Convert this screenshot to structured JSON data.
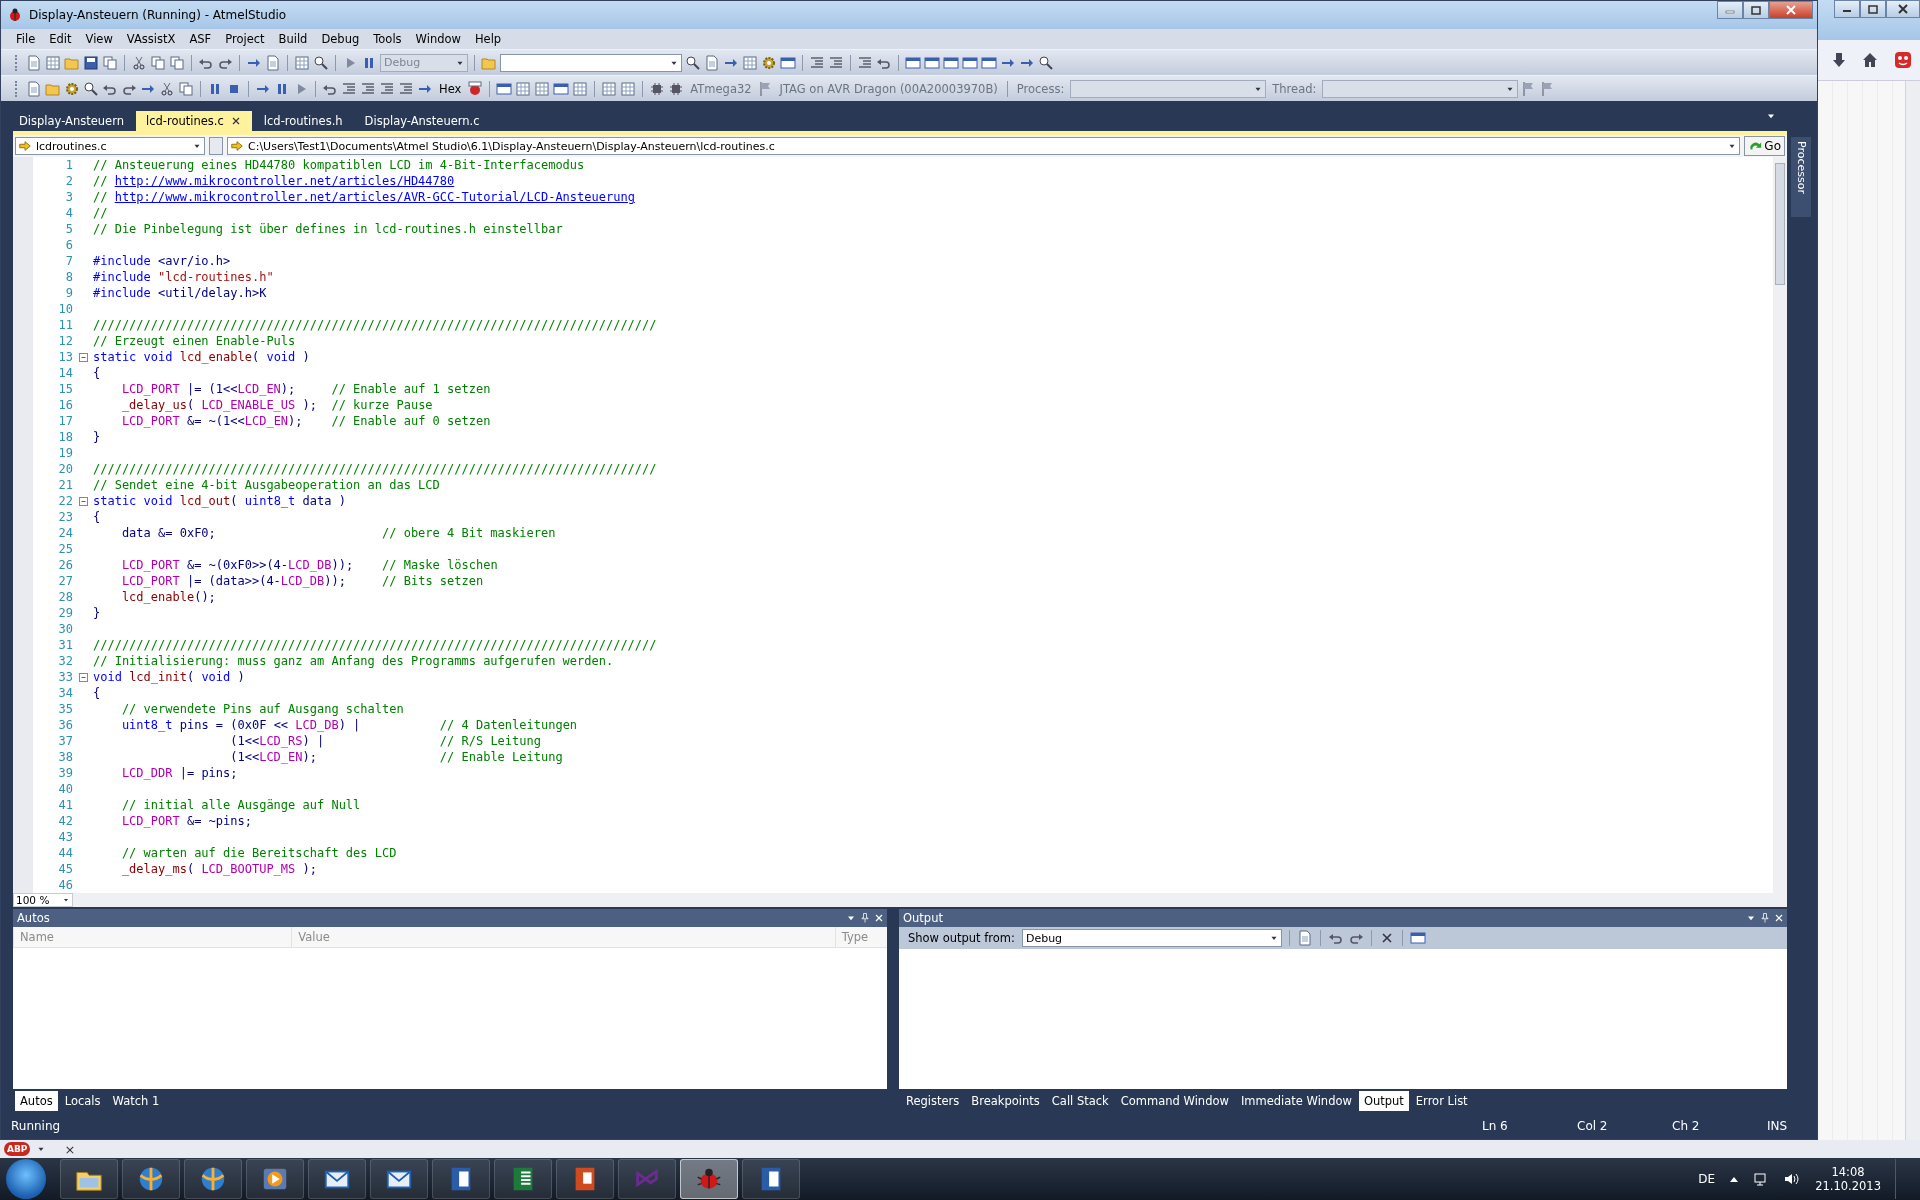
{
  "window": {
    "title": "Display-Ansteuern (Running) - AtmelStudio"
  },
  "menu": [
    "File",
    "Edit",
    "View",
    "VAssistX",
    "ASF",
    "Project",
    "Build",
    "Debug",
    "Tools",
    "Window",
    "Help"
  ],
  "toolbar_1": {
    "configuration": {
      "value": "Debug",
      "disabled": true
    }
  },
  "toolbar_2": {
    "hex": "Hex",
    "device": "ATmega32",
    "tool": "JTAG on AVR Dragon (00A20003970B)",
    "process_label": "Process:",
    "thread_label": "Thread:"
  },
  "doc_tabs": [
    {
      "label": "Display-Ansteuern",
      "selected": false
    },
    {
      "label": "lcd-routines.c",
      "selected": true
    },
    {
      "label": "lcd-routines.h",
      "selected": false
    },
    {
      "label": "Display-Ansteuern.c",
      "selected": false
    }
  ],
  "nav": {
    "file": "lcdroutines.c",
    "path": "C:\\Users\\Test1\\Documents\\Atmel Studio\\6.1\\Display-Ansteuern\\Display-Ansteuern\\lcd-routines.c",
    "go": "Go"
  },
  "side_tab": "Processor",
  "editor": {
    "zoom": "100 %",
    "lines": [
      {
        "n": "1",
        "tokens": [
          {
            "kind": "comment",
            "text": "// Ansteuerung eines HD44780 kompatiblen LCD im 4-Bit-Interfacemodus"
          }
        ]
      },
      {
        "n": "2",
        "tokens": [
          {
            "kind": "comment",
            "text": "// "
          },
          {
            "kind": "link",
            "text": "http://www.mikrocontroller.net/articles/HD44780"
          }
        ]
      },
      {
        "n": "3",
        "tokens": [
          {
            "kind": "comment",
            "text": "// "
          },
          {
            "kind": "link",
            "text": "http://www.mikrocontroller.net/articles/AVR-GCC-Tutorial/LCD-Ansteuerung"
          }
        ]
      },
      {
        "n": "4",
        "tokens": [
          {
            "kind": "comment",
            "text": "//"
          }
        ]
      },
      {
        "n": "5",
        "tokens": [
          {
            "kind": "comment",
            "text": "// Die Pinbelegung ist über defines in lcd-routines.h einstellbar"
          }
        ]
      },
      {
        "n": "6"
      },
      {
        "n": "7",
        "tokens": [
          {
            "kind": "directive",
            "text": "#include"
          },
          {
            "kind": "plain",
            "text": " <avr/io.h>"
          }
        ]
      },
      {
        "n": "8",
        "tokens": [
          {
            "kind": "directive",
            "text": "#include"
          },
          {
            "kind": "string",
            "text": " \"lcd-routines.h\""
          }
        ]
      },
      {
        "n": "9",
        "tokens": [
          {
            "kind": "directive",
            "text": "#include"
          },
          {
            "kind": "plain",
            "text": " <util/delay.h>K"
          }
        ]
      },
      {
        "n": "10"
      },
      {
        "n": "11",
        "tokens": [
          {
            "kind": "comment",
            "text": "//////////////////////////////////////////////////////////////////////////////"
          }
        ]
      },
      {
        "n": "12",
        "tokens": [
          {
            "kind": "comment",
            "text": "// Erzeugt einen Enable-Puls"
          }
        ]
      },
      {
        "n": "13",
        "fold": true,
        "tokens": [
          {
            "kind": "keyword",
            "text": "static void"
          },
          {
            "kind": "func",
            "text": " lcd_enable"
          },
          {
            "kind": "plain",
            "text": "( "
          },
          {
            "kind": "keyword",
            "text": "void"
          },
          {
            "kind": "plain",
            "text": " )"
          }
        ]
      },
      {
        "n": "14",
        "tokens": [
          {
            "kind": "plain",
            "text": "{"
          }
        ]
      },
      {
        "n": "15",
        "tokens": [
          {
            "kind": "macro",
            "text": "    LCD_PORT"
          },
          {
            "kind": "plain",
            "text": " |= (1<<"
          },
          {
            "kind": "macro",
            "text": "LCD_EN"
          },
          {
            "kind": "plain",
            "text": ");"
          },
          {
            "kind": "comment",
            "text": "     // Enable auf 1 setzen"
          }
        ]
      },
      {
        "n": "16",
        "tokens": [
          {
            "kind": "func",
            "text": "    _delay_us"
          },
          {
            "kind": "plain",
            "text": "( "
          },
          {
            "kind": "macro",
            "text": "LCD_ENABLE_US"
          },
          {
            "kind": "plain",
            "text": " );"
          },
          {
            "kind": "comment",
            "text": "  // kurze Pause"
          }
        ]
      },
      {
        "n": "17",
        "tokens": [
          {
            "kind": "macro",
            "text": "    LCD_PORT"
          },
          {
            "kind": "plain",
            "text": " &= ~(1<<"
          },
          {
            "kind": "macro",
            "text": "LCD_EN"
          },
          {
            "kind": "plain",
            "text": ");"
          },
          {
            "kind": "comment",
            "text": "    // Enable auf 0 setzen"
          }
        ]
      },
      {
        "n": "18",
        "tokens": [
          {
            "kind": "plain",
            "text": "}"
          }
        ]
      },
      {
        "n": "19"
      },
      {
        "n": "20",
        "tokens": [
          {
            "kind": "comment",
            "text": "//////////////////////////////////////////////////////////////////////////////"
          }
        ]
      },
      {
        "n": "21",
        "tokens": [
          {
            "kind": "comment",
            "text": "// Sendet eine 4-bit Ausgabeoperation an das LCD"
          }
        ]
      },
      {
        "n": "22",
        "fold": true,
        "tokens": [
          {
            "kind": "keyword",
            "text": "static void"
          },
          {
            "kind": "func",
            "text": " lcd_out"
          },
          {
            "kind": "plain",
            "text": "( "
          },
          {
            "kind": "keyword",
            "text": "uint8_t"
          },
          {
            "kind": "plain",
            "text": " data )"
          }
        ]
      },
      {
        "n": "23",
        "tokens": [
          {
            "kind": "plain",
            "text": "{"
          }
        ]
      },
      {
        "n": "24",
        "tokens": [
          {
            "kind": "plain",
            "text": "    data &= 0xF0;"
          },
          {
            "kind": "comment",
            "text": "                       // obere 4 Bit maskieren"
          }
        ]
      },
      {
        "n": "25"
      },
      {
        "n": "26",
        "tokens": [
          {
            "kind": "macro",
            "text": "    LCD_PORT"
          },
          {
            "kind": "plain",
            "text": " &= ~(0xF0>>(4-"
          },
          {
            "kind": "macro",
            "text": "LCD_DB"
          },
          {
            "kind": "plain",
            "text": "));"
          },
          {
            "kind": "comment",
            "text": "    // Maske löschen"
          }
        ]
      },
      {
        "n": "27",
        "tokens": [
          {
            "kind": "macro",
            "text": "    LCD_PORT"
          },
          {
            "kind": "plain",
            "text": " |= (data>>(4-"
          },
          {
            "kind": "macro",
            "text": "LCD_DB"
          },
          {
            "kind": "plain",
            "text": "));"
          },
          {
            "kind": "comment",
            "text": "     // Bits setzen"
          }
        ]
      },
      {
        "n": "28",
        "tokens": [
          {
            "kind": "func",
            "text": "    lcd_enable"
          },
          {
            "kind": "plain",
            "text": "();"
          }
        ]
      },
      {
        "n": "29",
        "tokens": [
          {
            "kind": "plain",
            "text": "}"
          }
        ]
      },
      {
        "n": "30"
      },
      {
        "n": "31",
        "tokens": [
          {
            "kind": "comment",
            "text": "//////////////////////////////////////////////////////////////////////////////"
          }
        ]
      },
      {
        "n": "32",
        "tokens": [
          {
            "kind": "comment",
            "text": "// Initialisierung: muss ganz am Anfang des Programms aufgerufen werden."
          }
        ]
      },
      {
        "n": "33",
        "fold": true,
        "tokens": [
          {
            "kind": "keyword",
            "text": "void"
          },
          {
            "kind": "func",
            "text": " lcd_init"
          },
          {
            "kind": "plain",
            "text": "( "
          },
          {
            "kind": "keyword",
            "text": "void"
          },
          {
            "kind": "plain",
            "text": " )"
          }
        ]
      },
      {
        "n": "34",
        "tokens": [
          {
            "kind": "plain",
            "text": "{"
          }
        ]
      },
      {
        "n": "35",
        "tokens": [
          {
            "kind": "comment",
            "text": "    // verwendete Pins auf Ausgang schalten"
          }
        ]
      },
      {
        "n": "36",
        "tokens": [
          {
            "kind": "keyword",
            "text": "    uint8_t"
          },
          {
            "kind": "plain",
            "text": " pins = (0x0F << "
          },
          {
            "kind": "macro",
            "text": "LCD_DB"
          },
          {
            "kind": "plain",
            "text": ") |"
          },
          {
            "kind": "comment",
            "text": "           // 4 Datenleitungen"
          }
        ]
      },
      {
        "n": "37",
        "tokens": [
          {
            "kind": "plain",
            "text": "                   (1<<"
          },
          {
            "kind": "macro",
            "text": "LCD_RS"
          },
          {
            "kind": "plain",
            "text": ") |"
          },
          {
            "kind": "comment",
            "text": "                // R/S Leitung"
          }
        ]
      },
      {
        "n": "38",
        "tokens": [
          {
            "kind": "plain",
            "text": "                   (1<<"
          },
          {
            "kind": "macro",
            "text": "LCD_EN"
          },
          {
            "kind": "plain",
            "text": ");"
          },
          {
            "kind": "comment",
            "text": "                 // Enable Leitung"
          }
        ]
      },
      {
        "n": "39",
        "tokens": [
          {
            "kind": "macro",
            "text": "    LCD_DDR"
          },
          {
            "kind": "plain",
            "text": " |= pins;"
          }
        ]
      },
      {
        "n": "40"
      },
      {
        "n": "41",
        "tokens": [
          {
            "kind": "comment",
            "text": "    // initial alle Ausgänge auf Null"
          }
        ]
      },
      {
        "n": "42",
        "tokens": [
          {
            "kind": "macro",
            "text": "    LCD_PORT"
          },
          {
            "kind": "plain",
            "text": " &= ~pins;"
          }
        ]
      },
      {
        "n": "43"
      },
      {
        "n": "44",
        "tokens": [
          {
            "kind": "comment",
            "text": "    // warten auf die Bereitschaft des LCD"
          }
        ]
      },
      {
        "n": "45",
        "tokens": [
          {
            "kind": "func",
            "text": "    _delay_ms"
          },
          {
            "kind": "plain",
            "text": "( "
          },
          {
            "kind": "macro",
            "text": "LCD_BOOTUP_MS"
          },
          {
            "kind": "plain",
            "text": " );"
          }
        ]
      },
      {
        "n": "46"
      }
    ]
  },
  "autos": {
    "title": "Autos",
    "columns": [
      "Name",
      "Value",
      "Type"
    ],
    "tabs": [
      {
        "label": "Autos",
        "selected": true
      },
      {
        "label": "Locals",
        "selected": false
      },
      {
        "label": "Watch 1",
        "selected": false
      }
    ]
  },
  "output": {
    "title": "Output",
    "show_label": "Show output from:",
    "source": "Debug",
    "tabs": [
      {
        "label": "Registers",
        "selected": false
      },
      {
        "label": "Breakpoints",
        "selected": false
      },
      {
        "label": "Call Stack",
        "selected": false
      },
      {
        "label": "Command Window",
        "selected": false
      },
      {
        "label": "Immediate Window",
        "selected": false
      },
      {
        "label": "Output",
        "selected": true
      },
      {
        "label": "Error List",
        "selected": false
      }
    ]
  },
  "status_bar": {
    "state": "Running",
    "ln": "Ln 6",
    "col": "Col 2",
    "ch": "Ch 2",
    "mode": "INS"
  },
  "addon_bar": {
    "badge": "ABP",
    "close": "×"
  },
  "taskbar": {
    "apps": [
      {
        "kind": "folder",
        "selected": false
      },
      {
        "kind": "globe",
        "selected": false
      },
      {
        "kind": "globe",
        "selected": false
      },
      {
        "kind": "play",
        "selected": false
      },
      {
        "kind": "envelope",
        "selected": false
      },
      {
        "kind": "envelope",
        "selected": false
      },
      {
        "kind": "document",
        "selected": false
      },
      {
        "kind": "sheet",
        "selected": false
      },
      {
        "kind": "slides",
        "selected": false
      },
      {
        "kind": "ribbon",
        "selected": false
      },
      {
        "kind": "bug",
        "selected": true
      },
      {
        "kind": "document",
        "selected": false
      }
    ],
    "language": "DE",
    "time": "14:08",
    "date": "21.10.2013"
  }
}
